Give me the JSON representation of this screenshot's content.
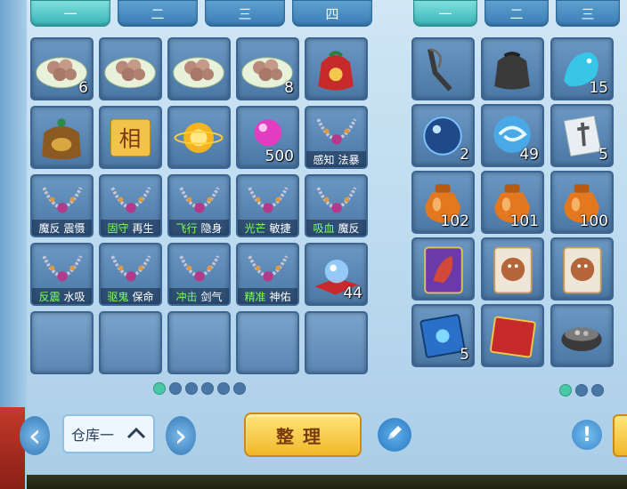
{
  "left_panel": {
    "tabs": [
      {
        "label": "一",
        "active": true
      },
      {
        "label": "二",
        "active": false
      },
      {
        "label": "三",
        "active": false
      },
      {
        "label": "四",
        "active": false
      }
    ],
    "items": [
      {
        "icon": "dumplings-plate-icon",
        "count": "6",
        "label": null
      },
      {
        "icon": "dumplings-plate-icon",
        "count": "",
        "label": null
      },
      {
        "icon": "dumplings-plate-icon",
        "count": "",
        "label": null
      },
      {
        "icon": "dumplings-plate-icon",
        "count": "8",
        "label": null
      },
      {
        "icon": "red-lucky-bag-icon",
        "count": "",
        "label": null
      },
      {
        "icon": "treasure-pouch-icon",
        "count": "",
        "label": null
      },
      {
        "icon": "xiang-scroll-icon",
        "count": "",
        "label": null,
        "glyph": "相"
      },
      {
        "icon": "golden-orb-icon",
        "count": "",
        "label": null
      },
      {
        "icon": "pink-pearl-icon",
        "count": "500",
        "label": null
      },
      {
        "icon": "necklace-icon",
        "count": "",
        "label": {
          "a": "感知",
          "b": "法暴",
          "a_green": false
        }
      },
      {
        "icon": "necklace-icon",
        "count": "",
        "label": {
          "a": "魔反",
          "b": "震慑",
          "a_green": false
        }
      },
      {
        "icon": "necklace-icon",
        "count": "",
        "label": {
          "a": "固守",
          "b": "再生",
          "a_green": true
        }
      },
      {
        "icon": "necklace-icon",
        "count": "",
        "label": {
          "a": "飞行",
          "b": "隐身",
          "a_green": true
        }
      },
      {
        "icon": "necklace-icon",
        "count": "",
        "label": {
          "a": "光芒",
          "b": "敏捷",
          "a_green": true
        }
      },
      {
        "icon": "necklace-icon",
        "count": "",
        "label": {
          "a": "吸血",
          "b": "魔反",
          "a_green": true
        }
      },
      {
        "icon": "necklace-icon",
        "count": "",
        "label": {
          "a": "反震",
          "b": "水吸",
          "a_green": true
        }
      },
      {
        "icon": "necklace-icon",
        "count": "",
        "label": {
          "a": "驱鬼",
          "b": "保命",
          "a_green": true
        }
      },
      {
        "icon": "necklace-icon",
        "count": "",
        "label": {
          "a": "冲击",
          "b": "剑气",
          "a_green": true
        }
      },
      {
        "icon": "necklace-icon",
        "count": "",
        "label": {
          "a": "精准",
          "b": "神佑",
          "a_green": true
        }
      },
      {
        "icon": "crystal-cushion-icon",
        "count": "44",
        "label": null
      },
      {
        "icon": "",
        "count": "",
        "label": null
      },
      {
        "icon": "",
        "count": "",
        "label": null
      },
      {
        "icon": "",
        "count": "",
        "label": null
      },
      {
        "icon": "",
        "count": "",
        "label": null
      },
      {
        "icon": "",
        "count": "",
        "label": null
      }
    ],
    "pages": 6,
    "current_page": 1
  },
  "right_panel": {
    "tabs": [
      {
        "label": "一",
        "active": true
      },
      {
        "label": "二",
        "active": false
      },
      {
        "label": "三",
        "active": false
      }
    ],
    "items": [
      {
        "icon": "slingshot-icon",
        "count": ""
      },
      {
        "icon": "black-pouch-icon",
        "count": ""
      },
      {
        "icon": "blue-dragon-icon",
        "count": "15"
      },
      {
        "icon": "blue-orb-icon",
        "count": "2"
      },
      {
        "icon": "swirl-orb-icon",
        "count": "49"
      },
      {
        "icon": "dagger-card-icon",
        "count": "5"
      },
      {
        "icon": "orange-jar-icon",
        "count": "102"
      },
      {
        "icon": "orange-jar-icon",
        "count": "101"
      },
      {
        "icon": "orange-jar-icon",
        "count": "100"
      },
      {
        "icon": "dragon-card-icon",
        "count": ""
      },
      {
        "icon": "beast-card-icon",
        "count": ""
      },
      {
        "icon": "beast-card-icon",
        "count": ""
      },
      {
        "icon": "blue-book-icon",
        "count": "5"
      },
      {
        "icon": "red-book-icon",
        "count": ""
      },
      {
        "icon": "cooking-pot-icon",
        "count": ""
      }
    ],
    "pages": 3,
    "current_page": 1
  },
  "bottom": {
    "warehouse_label": "仓库一",
    "sort_label": "整理",
    "prev_icon": "left-arrow-icon",
    "next_icon": "right-arrow-icon",
    "edit_icon": "pen-icon",
    "help_icon": "exclamation-icon"
  }
}
